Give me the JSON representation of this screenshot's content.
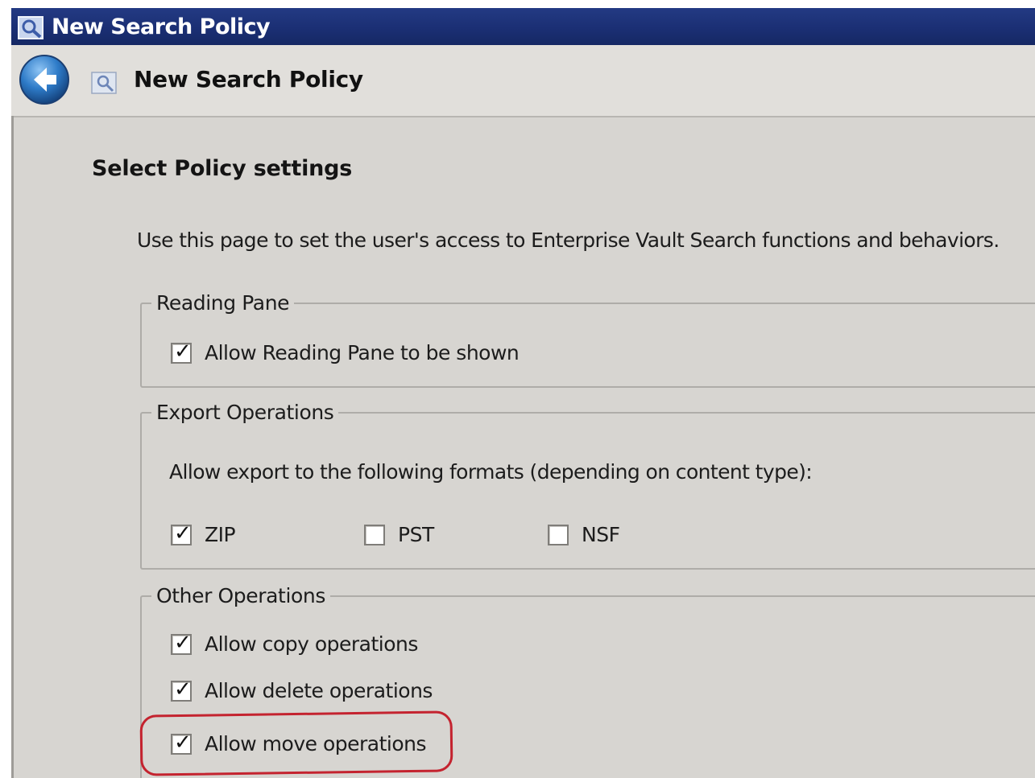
{
  "window": {
    "title": "New Search Policy",
    "icons": {
      "title": "search-policy-icon",
      "back": "back-arrow-icon",
      "nav": "search-policy-icon"
    }
  },
  "nav": {
    "title": "New Search Policy"
  },
  "page": {
    "heading": "Select Policy settings",
    "description": "Use this page to set the user's access to Enterprise Vault Search functions and behaviors."
  },
  "reading_pane": {
    "legend": "Reading Pane",
    "allow_reading_pane": {
      "label": "Allow Reading Pane to be shown",
      "checked": true
    }
  },
  "export_operations": {
    "legend": "Export Operations",
    "intro": "Allow export to the following formats (depending on content type):",
    "formats": [
      {
        "label": "ZIP",
        "checked": true
      },
      {
        "label": "PST",
        "checked": false
      },
      {
        "label": "NSF",
        "checked": false
      }
    ]
  },
  "other_operations": {
    "legend": "Other Operations",
    "items": [
      {
        "label": "Allow copy operations",
        "checked": true
      },
      {
        "label": "Allow delete operations",
        "checked": true
      },
      {
        "label": "Allow move operations",
        "checked": true
      }
    ]
  },
  "colors": {
    "titlebar": "#1b2f74",
    "window_bg": "#d7d5d1",
    "highlight": "#c4232f"
  }
}
